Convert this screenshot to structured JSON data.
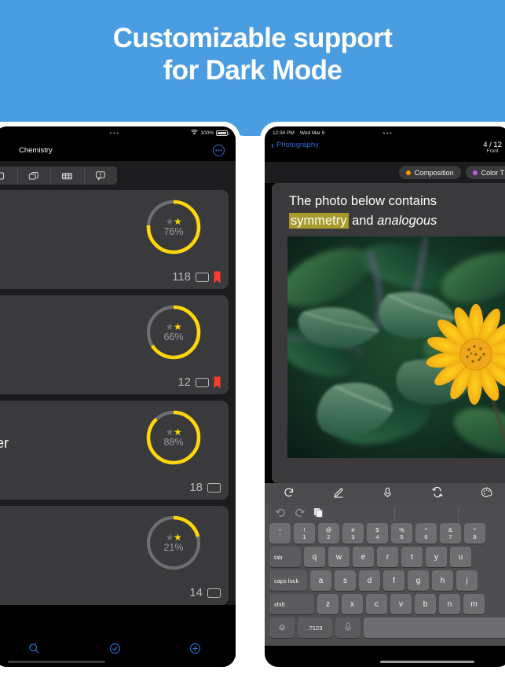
{
  "banner": {
    "line1": "Customizable support",
    "line2": "for Dark Mode",
    "bg_color": "#4a9de0",
    "text_color": "#ffffff"
  },
  "left_device": {
    "status_bar": {
      "dots": "•••",
      "wifi_icon": "wifi-icon",
      "battery_text": "100%",
      "battery_icon": "battery-icon"
    },
    "nav": {
      "title": "Chemistry",
      "more_button": "•••"
    },
    "tabs": [
      {
        "name": "tab-card",
        "icon": "single-card-icon"
      },
      {
        "name": "tab-decks",
        "icon": "stacked-cards-icon"
      },
      {
        "name": "tab-table",
        "icon": "table-grid-icon"
      },
      {
        "name": "tab-notes",
        "icon": "speech-bubble-icon"
      }
    ],
    "decks": [
      {
        "title": "",
        "percent": "76%",
        "percent_value": 76,
        "count": "118",
        "stars_filled": 1,
        "stars_total": 2,
        "bookmarked": true
      },
      {
        "title": "",
        "percent": "66%",
        "percent_value": 66,
        "count": "12",
        "stars_filled": 1,
        "stars_total": 2,
        "bookmarked": true
      },
      {
        "title": "ter",
        "percent": "88%",
        "percent_value": 88,
        "count": "18",
        "stars_filled": 1,
        "stars_total": 2,
        "bookmarked": false
      },
      {
        "title": "",
        "percent": "21%",
        "percent_value": 21,
        "count": "14",
        "stars_filled": 1,
        "stars_total": 2,
        "bookmarked": false
      }
    ],
    "toolbar": [
      {
        "name": "search-button",
        "icon": "search-icon"
      },
      {
        "name": "check-button",
        "icon": "check-circle-icon"
      },
      {
        "name": "add-button",
        "icon": "plus-circle-icon"
      }
    ],
    "colors": {
      "ring_fill": "#ffd60a",
      "ring_track": "#6e6e70",
      "bookmark": "#ff3b30",
      "accent": "#2f6ad0"
    }
  },
  "right_device": {
    "status_bar": {
      "time": "12:34 PM",
      "date": "Wed Mar 6",
      "dots": "•••"
    },
    "nav": {
      "back_label": "Photography",
      "counter": "4 / 12",
      "side_label": "Front"
    },
    "tags": [
      {
        "label": "Composition",
        "dot_color": "#ff9500"
      },
      {
        "label": "Color T",
        "dot_color": "#bf5af2"
      }
    ],
    "card": {
      "text_part1": "The photo below contains",
      "text_highlight": "symmetry",
      "text_part2": " and ",
      "text_italic": "analogous",
      "highlight_color": "#a89b2c",
      "photo_alt": "yellow-flower-photo"
    },
    "edit_toolbar": [
      {
        "name": "rotate-button",
        "icon": "rotate-icon"
      },
      {
        "name": "draw-button",
        "icon": "pencil-icon"
      },
      {
        "name": "audio-button",
        "icon": "microphone-icon"
      },
      {
        "name": "flip-button",
        "icon": "flip-shuffle-icon"
      },
      {
        "name": "palette-button",
        "icon": "palette-icon"
      }
    ],
    "keyboard": {
      "predictive": [
        {
          "name": "undo-button",
          "icon": "undo-icon"
        },
        {
          "name": "redo-button",
          "icon": "redo-icon"
        },
        {
          "name": "paste-button",
          "icon": "paste-icon"
        }
      ],
      "row_numbers": [
        {
          "top": "~",
          "bottom": "`"
        },
        {
          "top": "!",
          "bottom": "1"
        },
        {
          "top": "@",
          "bottom": "2"
        },
        {
          "top": "#",
          "bottom": "3"
        },
        {
          "top": "$",
          "bottom": "4"
        },
        {
          "top": "%",
          "bottom": "5"
        },
        {
          "top": "^",
          "bottom": "6"
        },
        {
          "top": "&",
          "bottom": "7"
        },
        {
          "top": "*",
          "bottom": "8"
        }
      ],
      "row_tab": {
        "modifier": "tab",
        "keys": [
          "q",
          "w",
          "e",
          "r",
          "t",
          "y",
          "u"
        ]
      },
      "row_caps": {
        "modifier": "caps lock",
        "keys": [
          "a",
          "s",
          "d",
          "f",
          "g",
          "h",
          "j"
        ]
      },
      "row_shift": {
        "modifier": "shift",
        "keys": [
          "z",
          "x",
          "c",
          "v",
          "b",
          "n",
          "m"
        ]
      },
      "row_bottom": [
        {
          "name": "emoji-key",
          "label": "☺"
        },
        {
          "name": "numeric-key",
          "label": ".?123"
        },
        {
          "name": "dictation-key",
          "label": ""
        },
        {
          "name": "space-key",
          "label": ""
        }
      ]
    }
  }
}
